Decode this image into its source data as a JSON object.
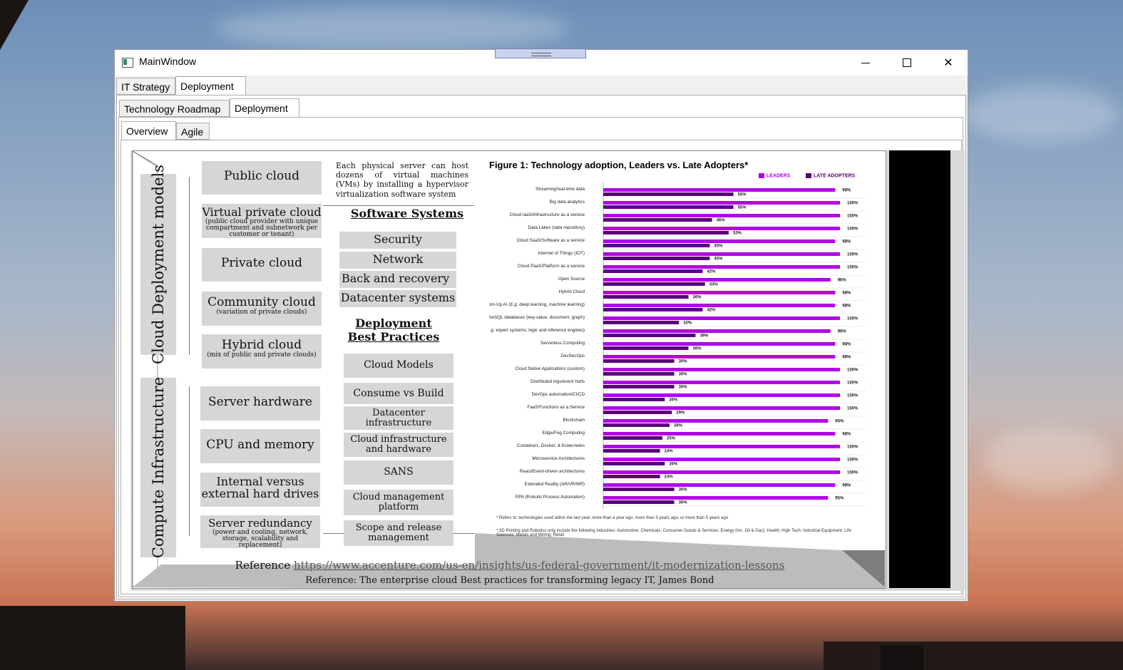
{
  "window": {
    "title": "MainWindow",
    "min": "",
    "max": "",
    "close": "✕"
  },
  "tabs_level1": [
    "IT Strategy",
    "Deployment"
  ],
  "tabs_level2": [
    "Technology Roadmap",
    "Deployment"
  ],
  "tabs_level3": [
    "Overview",
    "Agile"
  ],
  "slide": {
    "vlabel_top": "Cloud Deployment models",
    "vlabel_bottom": "Compute Infrastructure",
    "deploy_models": [
      {
        "title": "Public cloud",
        "sub": ""
      },
      {
        "title": "Virtual private cloud",
        "sub": "(public cloud provider with unique compartment and subnetwork per customer or tenant)"
      },
      {
        "title": "Private cloud",
        "sub": ""
      },
      {
        "title": "Community cloud",
        "sub": "(variation of private clouds)"
      },
      {
        "title": "Hybrid cloud",
        "sub": "(mix of public and private clouds)"
      }
    ],
    "compute": [
      {
        "title": "Server hardware",
        "sub": ""
      },
      {
        "title": "CPU and memory",
        "sub": ""
      },
      {
        "title": "Internal versus external hard drives",
        "sub": ""
      },
      {
        "title": "Server redundancy",
        "sub": "(power and cooling, network, storage, scalability and replacement)"
      }
    ],
    "paragraph": "Each physical server can host dozens of virtual machines (VMs) by installing a hypervisor virtualization software system",
    "software_header": "Software Systems",
    "software_items": [
      "Security",
      "Network",
      "Back and recovery",
      "Datacenter systems"
    ],
    "practices_header": "Deployment Best Practices",
    "practices_items": [
      "Cloud Models",
      "Consume vs Build",
      "Datacenter infrastructure",
      "Cloud infrastructure and hardware",
      "SANS",
      "Cloud management platform",
      "Scope and release management"
    ],
    "reference1_label": "Reference",
    "reference1_link": "https://www.accenture.com/us-en/insights/us-federal-government/it-modernization-lessons",
    "reference2": "Reference: The enterprise cloud Best practices for transforming legacy IT, James Bond"
  },
  "chart_data": {
    "type": "bar",
    "orientation": "horizontal",
    "title": "Figure 1: Technology adoption, Leaders vs. Late Adopters*",
    "legend_position": "top-right",
    "colors": {
      "leaders": "#b100e8",
      "late_adopters": "#5a0078"
    },
    "xlim": [
      0,
      100
    ],
    "categories": [
      "Streaming/real-time data",
      "Big data analytics",
      "Cloud IaaS/Infrastructure as a service",
      "Data Lakes (data repository)",
      "Cloud SaaS/Software as a service",
      "Internet of Things (IOT)",
      "Cloud PaaS/Platform as a service",
      "Open Source",
      "Hybrid Cloud",
      "Bottom-Up AI (E.g. deep learning, machine learning)",
      "NoSQL databases (key-value, document, graph)",
      "Top-Down AI (E.g. expert systems, logic and inference engines)",
      "Serverless Computing",
      "DevSecOps",
      "Cloud Native Applications (custom)",
      "Distributed logs/event hubs",
      "DevOps automation/CI/CD",
      "FaaS/Functions as a Service",
      "Blockchain",
      "Edge/Fog Computing",
      "Containers, Docker, & Kubernetes",
      "Microservice Architectures",
      "React/Event-driven architectures",
      "Extended Reality (AR/VR/MR)",
      "RPA (Robotic Process Automation)"
    ],
    "series": [
      {
        "name": "LEADERS",
        "values": [
          98,
          100,
          100,
          100,
          98,
          100,
          100,
          96,
          98,
          98,
          100,
          96,
          98,
          98,
          100,
          100,
          100,
          100,
          95,
          98,
          100,
          100,
          100,
          98,
          95
        ]
      },
      {
        "name": "LATE ADOPTERS",
        "values": [
          55,
          55,
          46,
          53,
          45,
          45,
          42,
          43,
          36,
          42,
          32,
          39,
          36,
          30,
          30,
          30,
          26,
          29,
          28,
          25,
          24,
          26,
          24,
          30,
          30
        ]
      }
    ],
    "notes": [
      "* Refers to: technologies used within the last year, more than a year ago, more than 3 years ago, or more than 5 years ago",
      "* 3D Printing and Robotics only include the following industries: Automotive; Chemicals; Consumer Goods & Services; Energy (Inc. Oil & Gas); Health; High Tech; Industrial Equipment; Life Sciences; Metals and Mining; Retail"
    ]
  }
}
